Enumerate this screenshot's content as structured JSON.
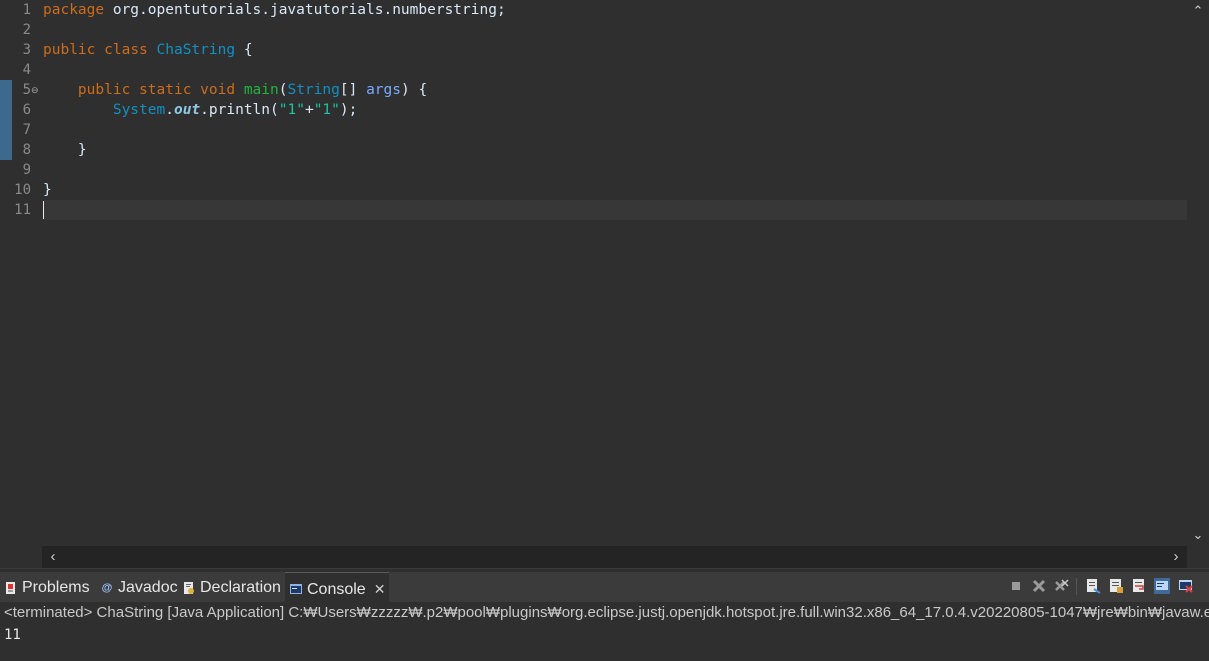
{
  "editor": {
    "line_numbers": [
      "1",
      "2",
      "3",
      "4",
      "5",
      "6",
      "7",
      "8",
      "9",
      "10",
      "11"
    ],
    "lines": {
      "l1": {
        "kw": "package",
        "rest": " org.opentutorials.javatutorials.numberstring;"
      },
      "l3": {
        "kw1": "public",
        "kw2": "class",
        "cls": "ChaString",
        "rest": " {"
      },
      "l5": {
        "kw1": "public",
        "kw2": "static",
        "kw3": "void",
        "method": "main",
        "p1": "(",
        "type": "String",
        "p2": "[] ",
        "param": "args",
        "p3": ") {"
      },
      "l6": {
        "cls": "System",
        "dot1": ".",
        "field": "out",
        "call": ".println(",
        "s1": "\"1\"",
        "plus": "+",
        "s2": "\"1\"",
        "end": ");"
      },
      "l8": {
        "brace": "}"
      },
      "l10": {
        "brace": "}"
      }
    },
    "fold_marker": "⊖",
    "scroll_up": "⌃",
    "scroll_down": "⌄",
    "scroll_left": "‹",
    "scroll_right": "›"
  },
  "panel": {
    "tabs": [
      {
        "label": "Problems",
        "icon": "problems-icon"
      },
      {
        "label": "Javadoc",
        "icon": "javadoc-icon"
      },
      {
        "label": "Declaration",
        "icon": "declaration-icon"
      },
      {
        "label": "Console",
        "icon": "console-icon",
        "active": true
      }
    ],
    "close_glyph": "✕",
    "status": "<terminated> ChaString [Java Application] C:₩Users₩zzzzz₩.p2₩pool₩plugins₩org.eclipse.justj.openjdk.hotspot.jre.full.win32.x86_64_17.0.4.v20220805-1047₩jre₩bin₩javaw.exe (",
    "output": "11"
  },
  "colors": {
    "background": "#2f2f2f",
    "keyword": "#cc6c1d",
    "class": "#1290c3",
    "method": "#1eb540",
    "string": "#17c6a3",
    "change_bar": "#3d6a8c"
  }
}
